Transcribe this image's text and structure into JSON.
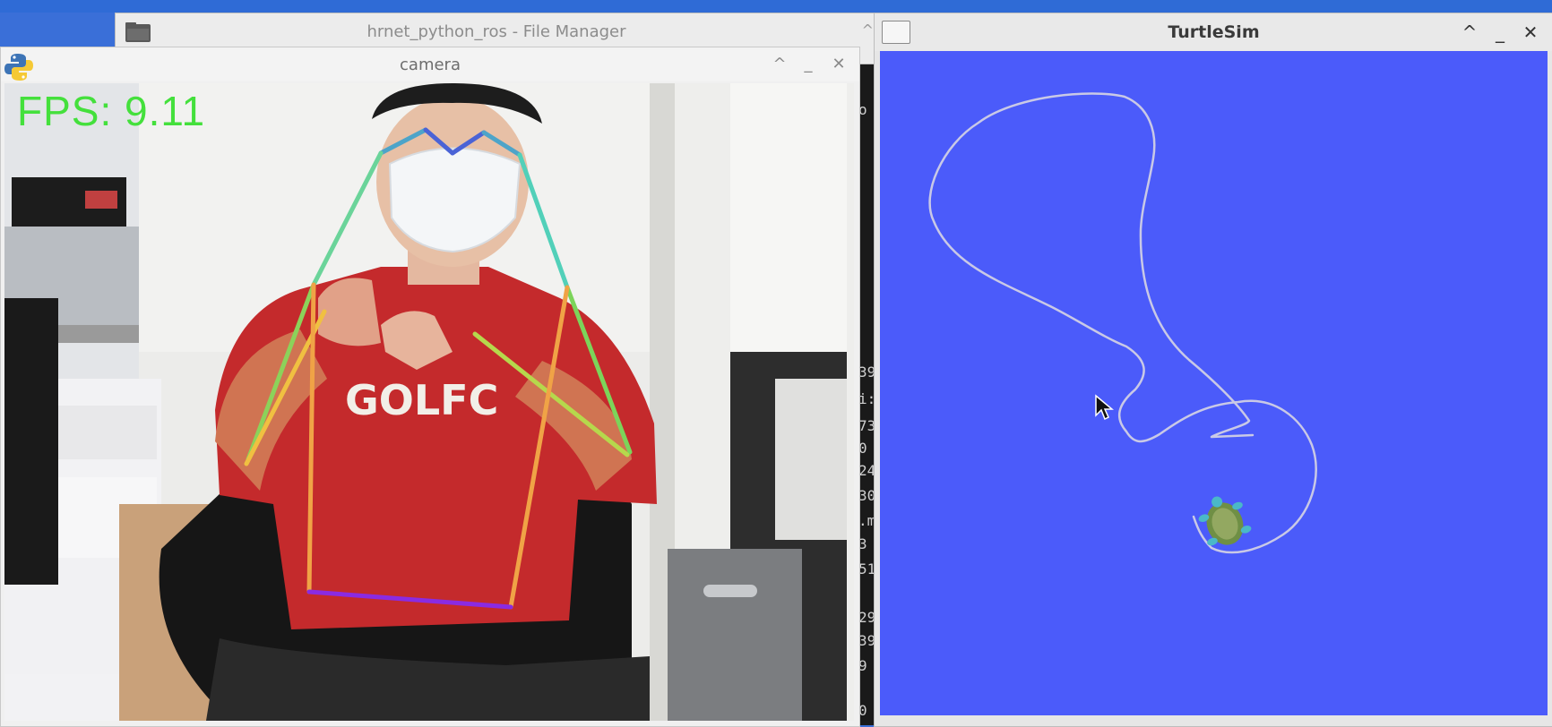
{
  "file_manager": {
    "title": "hrnet_python_ros - File Manager",
    "icon": "folder-icon",
    "maximize_glyph": "^"
  },
  "camera_window": {
    "title": "camera",
    "icon": "python-icon",
    "controls": {
      "maximize": "^",
      "minimize": "_",
      "close": "✕"
    },
    "fps_label": "FPS: 9.11",
    "fps_color": "#44e03c"
  },
  "turtlesim_window": {
    "title": "TurtleSim",
    "controls": {
      "maximize": "^",
      "minimize": "_",
      "close": "✕"
    },
    "background_color": "#4b5bfa",
    "path_color": "#c9c9e6"
  },
  "terminal_fragments": [
    "o",
    "39",
    "i:",
    "73",
    "0",
    "24",
    "30",
    ".m",
    "3",
    "51",
    "29",
    "39",
    "9",
    "0"
  ]
}
